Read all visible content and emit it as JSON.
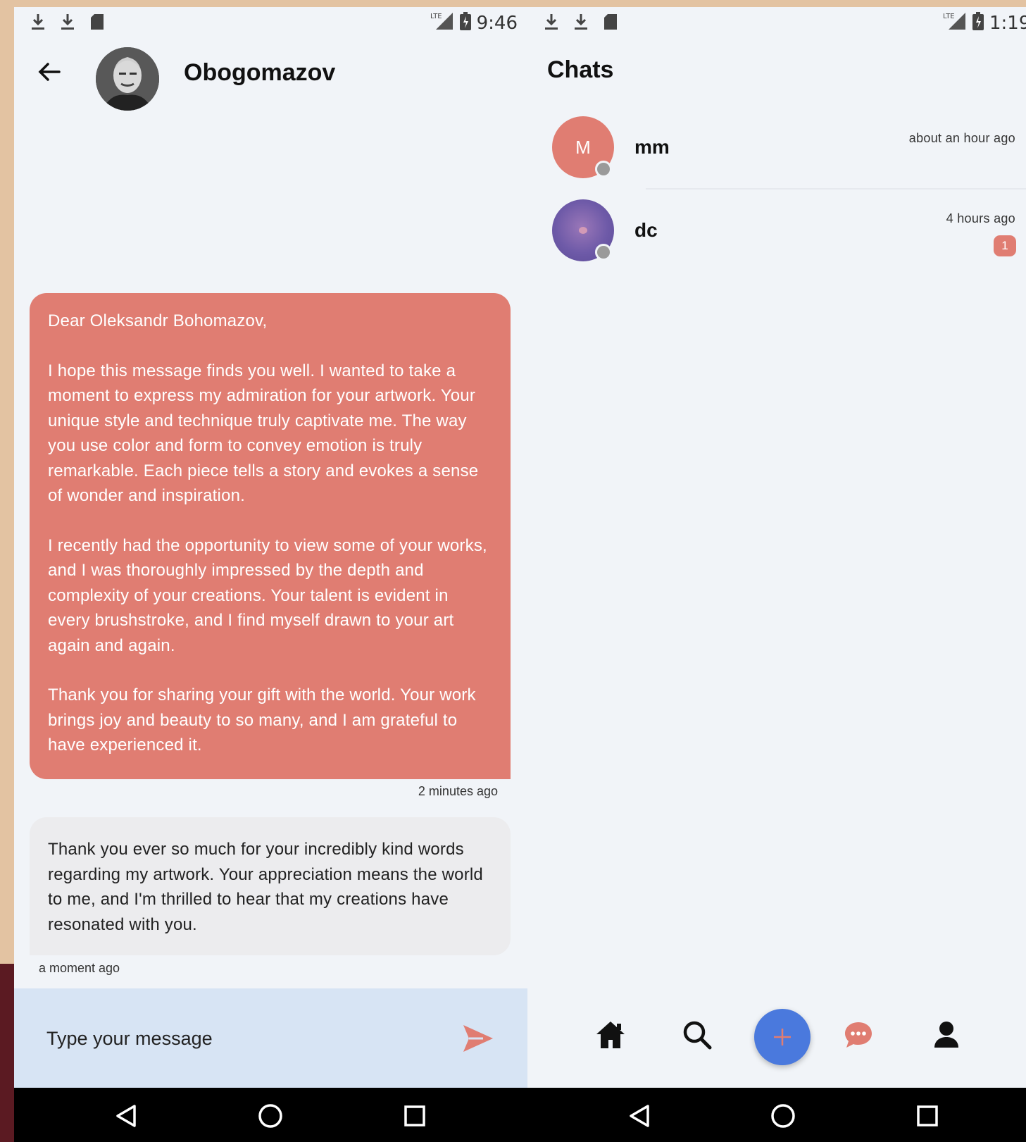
{
  "left_phone": {
    "status_bar": {
      "time": "9:46",
      "icons_left": [
        "download-icon",
        "download-icon",
        "sd-card-icon"
      ],
      "icons_right": [
        "lte-signal-icon",
        "battery-icon"
      ]
    },
    "header": {
      "title": "Obogomazov",
      "back_icon": "arrow-left-icon"
    },
    "messages": [
      {
        "direction": "outgoing",
        "paragraphs": [
          "Dear Oleksandr Bohomazov,",
          "I hope this message finds you well. I wanted to take a moment to express my admiration for your artwork. Your unique style and technique truly captivate me. The way you use color and form to convey emotion is truly remarkable. Each piece tells a story and evokes a sense of wonder and inspiration.",
          "I recently had the opportunity to view some of your works, and I was thoroughly impressed by the depth and complexity of your creations. Your talent is evident in every brushstroke, and I find myself drawn to your art again and again.",
          "Thank you for sharing your gift with the world. Your work brings joy and beauty to so many, and I am grateful to have experienced it."
        ],
        "time": "2 minutes ago"
      },
      {
        "direction": "incoming",
        "text": "Thank you ever so much for your incredibly kind words regarding my artwork. Your appreciation means the world to me, and I'm thrilled to hear that my creations have resonated with you.",
        "time": "a moment ago"
      }
    ],
    "composer": {
      "placeholder": "Type your message",
      "value": "",
      "send_icon": "send-icon"
    }
  },
  "right_phone": {
    "status_bar": {
      "time": "1:19",
      "icons_left": [
        "download-icon",
        "download-icon",
        "sd-card-icon"
      ],
      "icons_right": [
        "lte-signal-icon",
        "battery-icon"
      ]
    },
    "title": "Chats",
    "chats": [
      {
        "name": "mm",
        "avatar_initial": "M",
        "avatar_color": "#e07d72",
        "time": "about an hour ago",
        "unread": null
      },
      {
        "name": "dc",
        "avatar_initial": "",
        "avatar_color": "#6c5aa6",
        "time": "4 hours ago",
        "unread": "1"
      }
    ],
    "bottom_tabs": [
      "home-icon",
      "search-icon",
      "plus-icon",
      "chat-icon",
      "profile-icon"
    ]
  },
  "colors": {
    "accent": "#e07d72",
    "fab": "#4a79dd",
    "composer_bg": "#d7e4f4",
    "incoming_bubble": "#ececee",
    "page_bg": "#f1f4f8"
  },
  "system_nav": [
    "back-triangle-icon",
    "home-circle-icon",
    "recents-square-icon"
  ]
}
